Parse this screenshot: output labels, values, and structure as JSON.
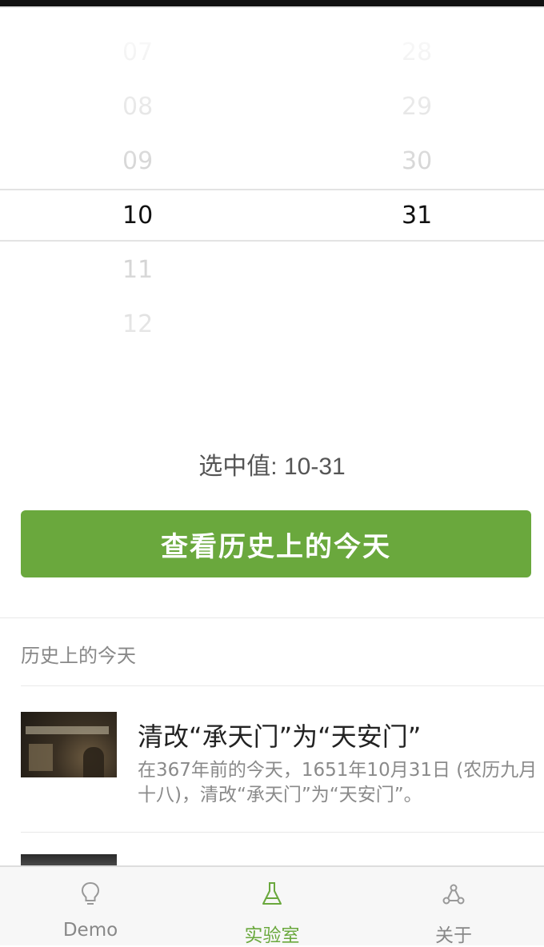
{
  "picker": {
    "months": [
      "07",
      "08",
      "09",
      "10",
      "11",
      "12"
    ],
    "days": [
      "28",
      "29",
      "30",
      "31"
    ],
    "selected_month": "10",
    "selected_day": "31"
  },
  "selected_value": "选中值: 10-31",
  "button_label": "查看历史上的今天",
  "section": {
    "title": "历史上的今天"
  },
  "events": [
    {
      "title": "清改“承天门”为“天安门”",
      "description": "在367年前的今天，1651年10月31日 (农历九月十八)，清改“承天门”为“天安门”。"
    }
  ],
  "tabbar": {
    "items": [
      {
        "label": "Demo",
        "icon": "lightbulb-icon",
        "active": false
      },
      {
        "label": "实验室",
        "icon": "flask-icon",
        "active": true
      },
      {
        "label": "关于",
        "icon": "nodes-icon",
        "active": false
      }
    ],
    "active_color": "#6aa83d"
  },
  "colors": {
    "accent": "#6aa83d"
  }
}
